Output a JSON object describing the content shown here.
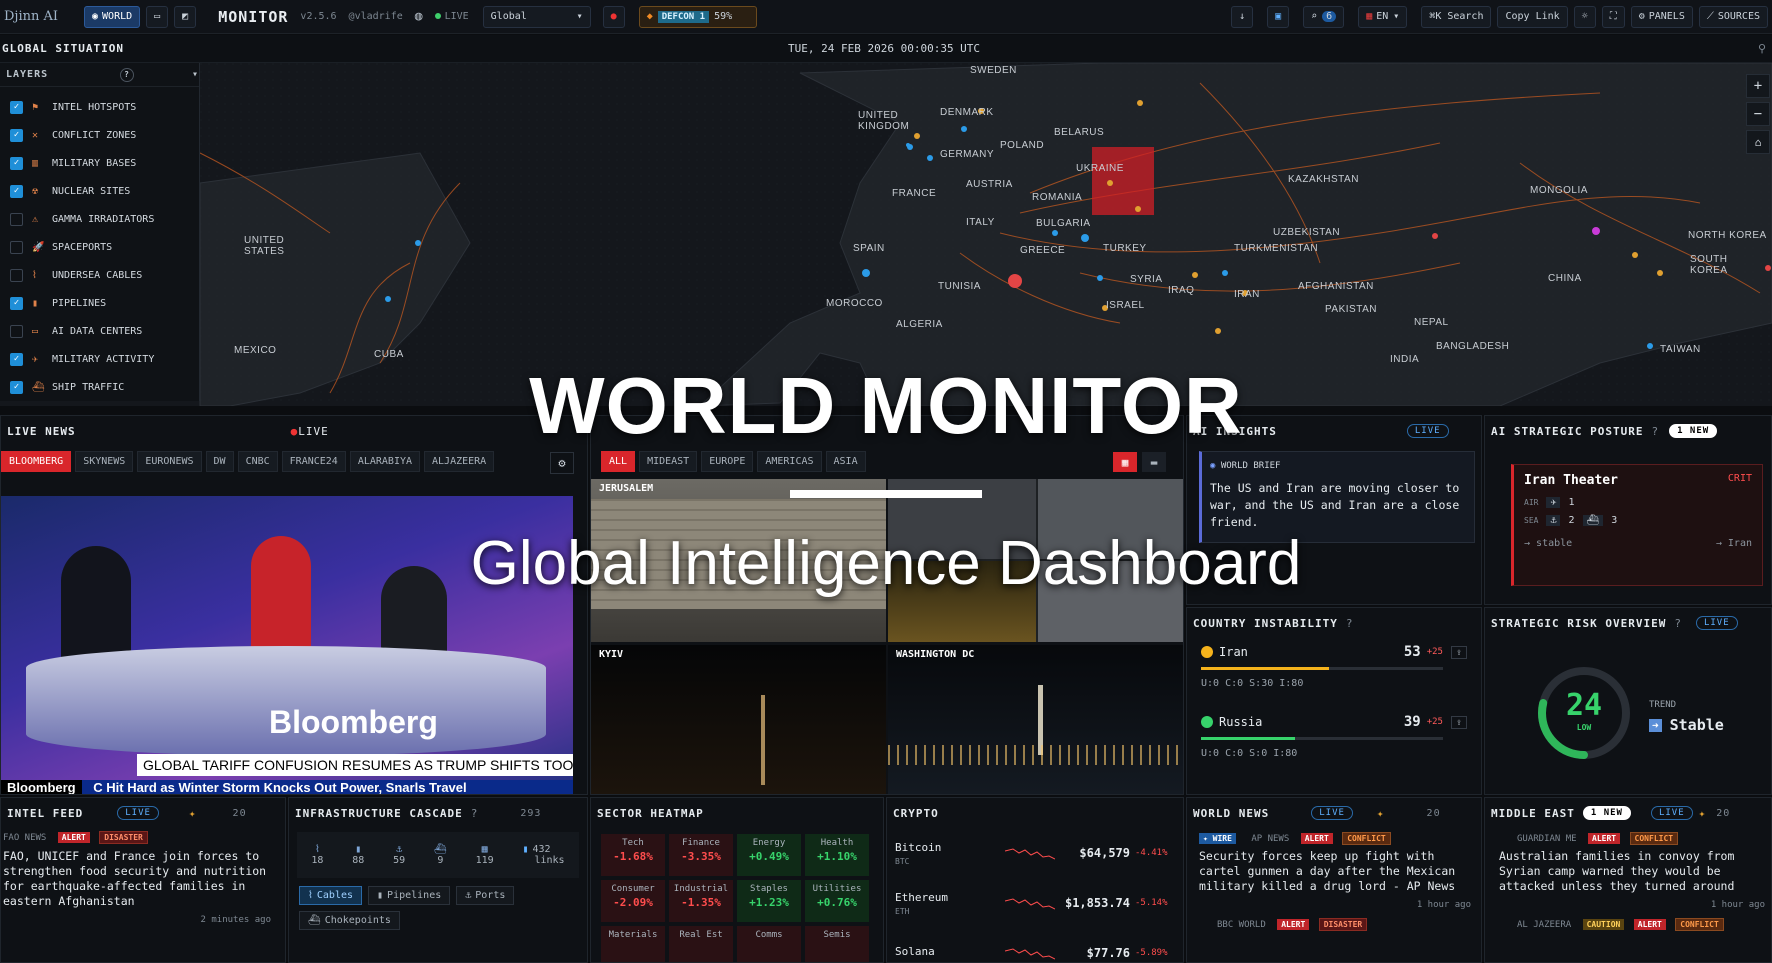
{
  "topbar": {
    "logo": "Djinn AI",
    "mode_world": "WORLD",
    "title": "MONITOR",
    "version": "v2.5.6",
    "author": "@vladrife",
    "live": "LIVE",
    "region": "Global",
    "defcon_label": "DEFCON 1",
    "defcon_pct": "59%",
    "search_count": "6",
    "lang": "EN",
    "search": "Search",
    "copy_link": "Copy Link",
    "panels": "PANELS",
    "sources": "SOURCES"
  },
  "situation": {
    "title": "GLOBAL SITUATION",
    "datetime": "TUE, 24 FEB 2026 00:00:35 UTC"
  },
  "layers": {
    "title": "LAYERS",
    "help": "?",
    "items": [
      {
        "label": "INTEL HOTSPOTS",
        "checked": true
      },
      {
        "label": "CONFLICT ZONES",
        "checked": true
      },
      {
        "label": "MILITARY BASES",
        "checked": true
      },
      {
        "label": "NUCLEAR SITES",
        "checked": true
      },
      {
        "label": "GAMMA IRRADIATORS",
        "checked": false
      },
      {
        "label": "SPACEPORTS",
        "checked": false
      },
      {
        "label": "UNDERSEA CABLES",
        "checked": false
      },
      {
        "label": "PIPELINES",
        "checked": true
      },
      {
        "label": "AI DATA CENTERS",
        "checked": false
      },
      {
        "label": "MILITARY ACTIVITY",
        "checked": true
      },
      {
        "label": "SHIP TRAFFIC",
        "checked": true
      }
    ]
  },
  "map_labels": {
    "sweden": "SWEDEN",
    "denmark": "DENMARK",
    "uk": "UNITED KINGDOM",
    "poland": "POLAND",
    "belarus": "BELARUS",
    "germany": "GERMANY",
    "ukraine": "UKRAINE",
    "france": "FRANCE",
    "austria": "AUSTRIA",
    "romania": "ROMANIA",
    "kazakhstan": "KAZAKHSTAN",
    "mongolia": "MONGOLIA",
    "italy": "ITALY",
    "bulgaria": "BULGARIA",
    "us": "UNITED STATES",
    "spain": "SPAIN",
    "greece": "GREECE",
    "turkey": "TURKEY",
    "uzbekistan": "UZBEKISTAN",
    "turkmenistan": "TURKMENISTAN",
    "north_korea": "NORTH KOREA",
    "south_korea": "SOUTH KOREA",
    "china": "CHINA",
    "syria": "SYRIA",
    "afghanistan": "AFGHANISTAN",
    "morocco": "MOROCCO",
    "tunisia": "TUNISIA",
    "iraq": "IRAQ",
    "iran": "IRAN",
    "israel": "ISRAEL",
    "pakistan": "PAKISTAN",
    "algeria": "ALGERIA",
    "nepal": "NEPAL",
    "mexico": "MEXICO",
    "cuba": "CUBA",
    "bangladesh": "BANGLADESH",
    "india": "INDIA",
    "taiwan": "TAIWAN"
  },
  "hero": {
    "title": "WORLD MONITOR",
    "subtitle": "Global Intelligence Dashboard"
  },
  "live_news": {
    "title": "LIVE NEWS",
    "live": "LIVE",
    "channels": [
      "BLOOMBERG",
      "SKYNEWS",
      "EURONEWS",
      "DW",
      "CNBC",
      "FRANCE24",
      "ALARABIYA",
      "ALJAZEERA"
    ],
    "brand": "Bloomberg",
    "lower_third": "GLOBAL TARIFF CONFUSION RESUMES AS TRUMP SHIFTS TOOLS",
    "ticker_brand": "Bloomberg",
    "ticker": "C Hit Hard as Winter Storm Knocks Out Power, Snarls Travel"
  },
  "webcams": {
    "tabs": [
      "ALL",
      "MIDEAST",
      "EUROPE",
      "AMERICAS",
      "ASIA"
    ],
    "cams": [
      "JERUSALEM",
      "KYIV",
      "WASHINGTON DC"
    ]
  },
  "ai_insights": {
    "title": "AI INSIGHTS",
    "live": "LIVE",
    "brief_label": "WORLD BRIEF",
    "brief": "The US and Iran are moving closer to war, and the US and Iran are a close friend."
  },
  "posture": {
    "title": "AI STRATEGIC POSTURE",
    "new": "1 NEW",
    "theater": "Iran Theater",
    "level": "CRIT",
    "air_label": "AIR",
    "air": "1",
    "sea_label": "SEA",
    "sea1": "2",
    "sea2": "3",
    "trend": "stable",
    "target": "Iran"
  },
  "instability": {
    "title": "COUNTRY INSTABILITY",
    "rows": [
      {
        "name": "Iran",
        "score": "53",
        "delta": "+25",
        "stats": "U:0  C:0  S:30  I:80",
        "color": "#f5b31c",
        "level": 0.53
      },
      {
        "name": "Russia",
        "score": "39",
        "delta": "+25",
        "stats": "U:0  C:0  S:0  I:80",
        "color": "#37d36b",
        "level": 0.39
      }
    ]
  },
  "risk": {
    "title": "STRATEGIC RISK OVERVIEW",
    "live": "LIVE",
    "score": "24",
    "score_label": "LOW",
    "trend_label": "TREND",
    "trend": "Stable",
    "score_fraction": 0.24
  },
  "intel_feed": {
    "title": "INTEL FEED",
    "live": "LIVE",
    "count": "20",
    "source": "FAO NEWS",
    "tag1": "ALERT",
    "tag2": "DISASTER",
    "text": "FAO, UNICEF and France join forces to strengthen food security and nutrition for earthquake-affected families in eastern Afghanistan",
    "time": "2 minutes ago"
  },
  "infra": {
    "title": "INFRASTRUCTURE CASCADE",
    "count": "293",
    "stats": [
      "18",
      "88",
      "59",
      "9",
      "119"
    ],
    "links_value": "432",
    "links_label": "links",
    "tabs": [
      "Cables",
      "Pipelines",
      "Ports",
      "Chokepoints"
    ]
  },
  "heatmap": {
    "title": "SECTOR HEATMAP",
    "cells": [
      {
        "name": "Tech",
        "value": "-1.68%",
        "color": "#ff4d4d"
      },
      {
        "name": "Finance",
        "value": "-3.35%",
        "color": "#ff4d4d"
      },
      {
        "name": "Energy",
        "value": "+0.49%",
        "color": "#37d36b"
      },
      {
        "name": "Health",
        "value": "+1.10%",
        "color": "#37d36b"
      },
      {
        "name": "Consumer",
        "value": "-2.09%",
        "color": "#ff4d4d"
      },
      {
        "name": "Industrial",
        "value": "-1.35%",
        "color": "#ff4d4d"
      },
      {
        "name": "Staples",
        "value": "+1.23%",
        "color": "#37d36b"
      },
      {
        "name": "Utilities",
        "value": "+0.76%",
        "color": "#37d36b"
      },
      {
        "name": "Materials",
        "value": "",
        "color": "#ff4d4d"
      },
      {
        "name": "Real Est",
        "value": "",
        "color": "#ff4d4d"
      },
      {
        "name": "Comms",
        "value": "",
        "color": "#ff4d4d"
      },
      {
        "name": "Semis",
        "value": "",
        "color": "#ff4d4d"
      }
    ]
  },
  "crypto": {
    "title": "CRYPTO",
    "rows": [
      {
        "name": "Bitcoin",
        "sym": "BTC",
        "price": "$64,579",
        "chg": "-4.41%"
      },
      {
        "name": "Ethereum",
        "sym": "ETH",
        "price": "$1,853.74",
        "chg": "-5.14%"
      },
      {
        "name": "Solana",
        "sym": "",
        "price": "$77.76",
        "chg": "-5.89%"
      }
    ]
  },
  "world_news": {
    "title": "WORLD NEWS",
    "live": "LIVE",
    "count": "20",
    "wire": "WIRE",
    "source": "AP NEWS",
    "tag1": "ALERT",
    "tag2": "CONFLICT",
    "text": "Security forces keep up fight with cartel gunmen a day after the Mexican military killed a drug lord - AP News",
    "time": "1 hour ago",
    "source2": "BBC WORLD",
    "tag3": "ALERT",
    "tag4": "DISASTER"
  },
  "middle_east": {
    "title": "MIDDLE EAST",
    "new": "1 NEW",
    "live": "LIVE",
    "count": "20",
    "source": "GUARDIAN ME",
    "tag1": "ALERT",
    "tag2": "CONFLICT",
    "text": "Australian families in convoy from Syrian camp warned they would be attacked unless they turned around",
    "time": "1 hour ago",
    "source2": "AL JAZEERA",
    "tag3": "CAUTION",
    "tag4": "ALERT",
    "tag5": "CONFLICT"
  },
  "colors": {
    "accent": "#1f8fd8",
    "alert": "#d9262b",
    "up": "#37d36b",
    "down": "#ff4d4d"
  }
}
